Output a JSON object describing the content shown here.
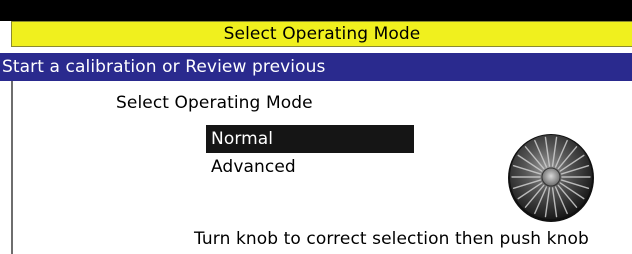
{
  "colors": {
    "title_bg": "#f0f01e",
    "subtitle_bg": "#2a2a8e",
    "selected_bg": "#151515"
  },
  "header": {
    "title": "Select Operating Mode"
  },
  "subheader": {
    "text": "Start a calibration or Review previous"
  },
  "main": {
    "prompt": "Select Operating Mode",
    "menu": [
      {
        "label": "Normal",
        "selected": true
      },
      {
        "label": "Advanced",
        "selected": false
      }
    ],
    "knob_icon": "rotary-knob-icon",
    "instruction": "Turn knob to correct selection then push knob"
  }
}
